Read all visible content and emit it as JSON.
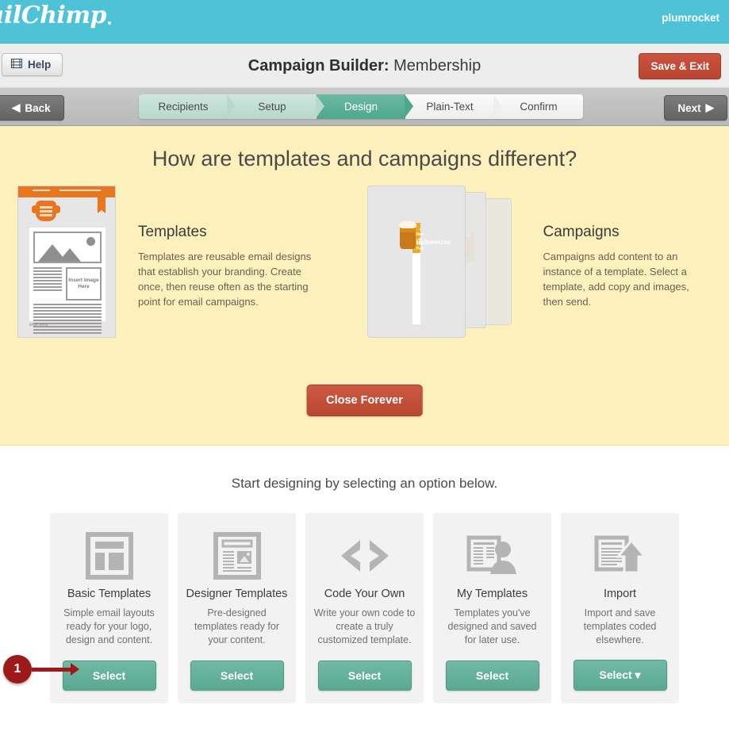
{
  "brand": {
    "logo_text": "ailChimp",
    "username": "plumrocket",
    "bar_color": "#4ec3d8"
  },
  "titlebar": {
    "help_label": "Help",
    "title_prefix": "Campaign Builder:",
    "title_name": " Membership",
    "save_exit_label": "Save & Exit"
  },
  "stepsbar": {
    "back_label": "Back",
    "next_label": "Next",
    "steps": [
      {
        "label": "Recipients",
        "state": "done"
      },
      {
        "label": "Setup",
        "state": "done"
      },
      {
        "label": "Design",
        "state": "active"
      },
      {
        "label": "Plain-Text",
        "state": "todo"
      },
      {
        "label": "Confirm",
        "state": "todo"
      }
    ]
  },
  "promo": {
    "heading": "How are templates and campaigns different?",
    "templates": {
      "title": "Templates",
      "body": "Templates are reusable email designs that establish your branding. Create once, then reuse often as the starting point for email campaigns.",
      "thumb_insert_text": "Insert Image Here",
      "thumb_footer_logo": "MailChimp"
    },
    "campaigns": {
      "title": "Campaigns",
      "body": "Campaigns add content to an instance of a template. Select a template, add copy and images, then send.",
      "hero_kicker": "• New at the Pub •",
      "hero_sub": "Freshly Tapped",
      "hero_title": "Hefeweizen"
    },
    "close_label": "Close Forever",
    "background_color": "#fcf0bd"
  },
  "options": {
    "heading": "Start designing by selecting an option below.",
    "cards": [
      {
        "icon": "layout-grid-icon",
        "title": "Basic Templates",
        "body": "Simple email layouts ready for your logo, design and content.",
        "button_label": "Select",
        "has_caret": false
      },
      {
        "icon": "page-layout-icon",
        "title": "Designer Templates",
        "body": "Pre-designed templates ready for your content.",
        "button_label": "Select",
        "has_caret": false
      },
      {
        "icon": "code-brackets-icon",
        "title": "Code Your Own",
        "body": "Write your own code to create a truly customized template.",
        "button_label": "Select",
        "has_caret": false
      },
      {
        "icon": "document-person-icon",
        "title": "My Templates",
        "body": "Templates you've designed and saved for later use.",
        "button_label": "Select",
        "has_caret": false
      },
      {
        "icon": "document-upload-icon",
        "title": "Import",
        "body": "Import and save templates coded elsewhere.",
        "button_label": "Select ▾",
        "has_caret": true
      }
    ]
  },
  "annotation": {
    "number": "1",
    "color": "#9e1919"
  },
  "colors": {
    "accent_teal": "#4ec3d8",
    "select_green": "#5aa992",
    "danger_red": "#b94631",
    "active_step": "#4ea78c"
  }
}
